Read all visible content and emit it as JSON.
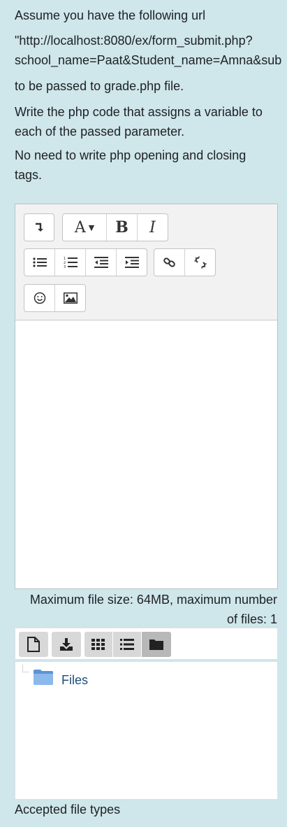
{
  "question": {
    "line1": "Assume you have the following url",
    "url_line1": "\"http://localhost:8080/ex/form_submit.php?",
    "url_line2": "school_name=Paat&Student_name=Amna&sub",
    "line3": "to be passed to grade.php file.",
    "line4a": "Write the php code that assigns a variable to",
    "line4b": "each of the passed parameter.",
    "line5a": "No need to write php opening and closing",
    "line5b": "tags."
  },
  "editor": {
    "toolbar": {
      "row1": [
        {
          "name": "toggle-toolbar",
          "icon": "collapse-icon",
          "label": "↴"
        },
        {
          "name": "paragraph-styles",
          "icon": "font-styles-icon",
          "label": "A▾"
        },
        {
          "name": "bold",
          "icon": "bold-icon",
          "label": "B"
        },
        {
          "name": "italic",
          "icon": "italic-icon",
          "label": "I"
        }
      ],
      "row2": [
        {
          "name": "unordered-list",
          "icon": "bullet-list-icon"
        },
        {
          "name": "ordered-list",
          "icon": "numbered-list-icon"
        },
        {
          "name": "outdent",
          "icon": "outdent-icon"
        },
        {
          "name": "indent",
          "icon": "indent-icon"
        },
        {
          "name": "link",
          "icon": "link-icon"
        },
        {
          "name": "unlink",
          "icon": "unlink-icon"
        }
      ],
      "row3": [
        {
          "name": "emoticon",
          "icon": "smiley-icon"
        },
        {
          "name": "image",
          "icon": "image-icon"
        }
      ]
    },
    "content": ""
  },
  "file_limits": {
    "line1": "Maximum file size: 64MB, maximum number",
    "line2": "of files: 1"
  },
  "filepicker": {
    "toolbar": [
      "add-file-icon",
      "download-icon",
      "icons-view-icon",
      "list-view-icon",
      "tree-view-icon"
    ],
    "folder_label": "Files"
  },
  "accepted_types_label": "Accepted file types"
}
